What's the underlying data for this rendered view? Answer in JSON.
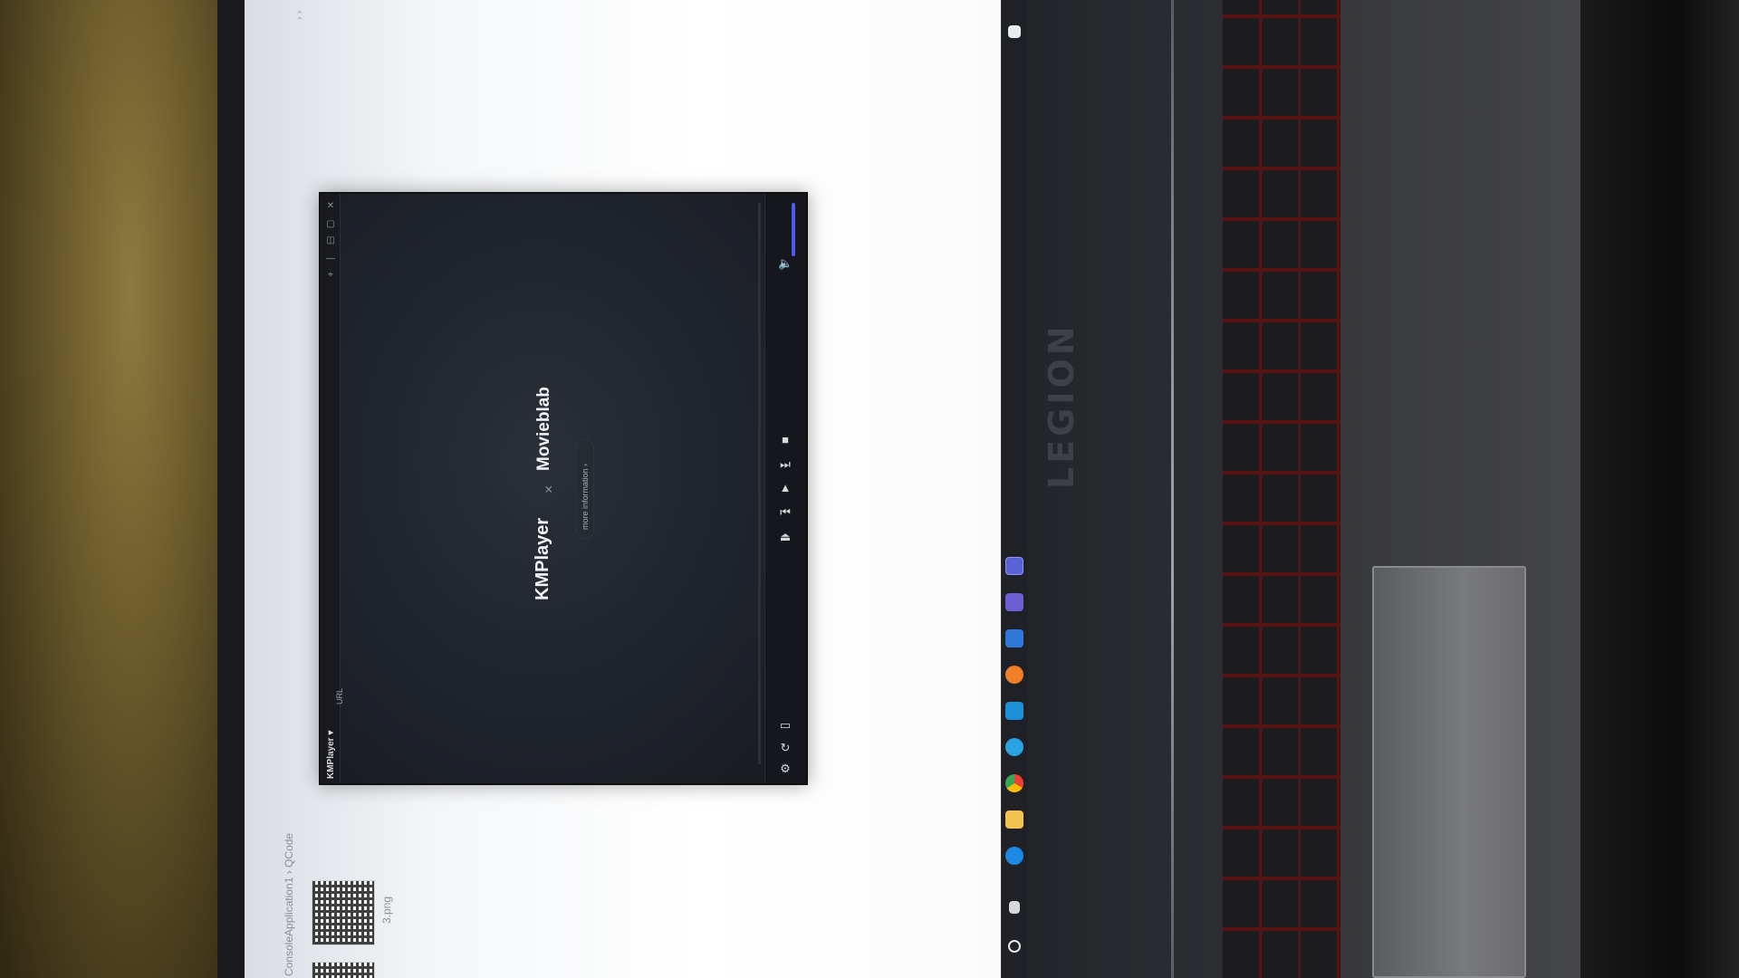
{
  "scene": {
    "laptop_brand": "LEGION"
  },
  "explorer": {
    "breadcrumb": "ConsoleApplication1 › QCode",
    "file_caption": "3.png"
  },
  "player": {
    "title": "KMPlayer ▾",
    "url_label": "URL",
    "logo_primary": "KMPlayer",
    "logo_separator": "×",
    "logo_partner": "Movieblab",
    "info_button": "more information ›",
    "volume_level": 0.35,
    "icons": [
      "close-icon",
      "maximize-icon",
      "minimize-icon",
      "pin-icon",
      "play-icon",
      "prev-icon",
      "next-icon",
      "stop-icon",
      "eject-icon",
      "volume-icon",
      "playlist-icon",
      "settings-icon"
    ]
  },
  "taskbar": {
    "icons": [
      "start-icon",
      "taskview-icon",
      "edge-icon",
      "file-explorer-icon",
      "chrome-icon",
      "telegram-icon",
      "store-icon",
      "app-icon",
      "mail-icon",
      "kmplayer-icon",
      "kmplayer-active-icon"
    ],
    "colors": {
      "orange": "#f07f2a",
      "blue": "#2f78d8",
      "purple": "#6b5fd3",
      "green": "#33a853"
    }
  }
}
